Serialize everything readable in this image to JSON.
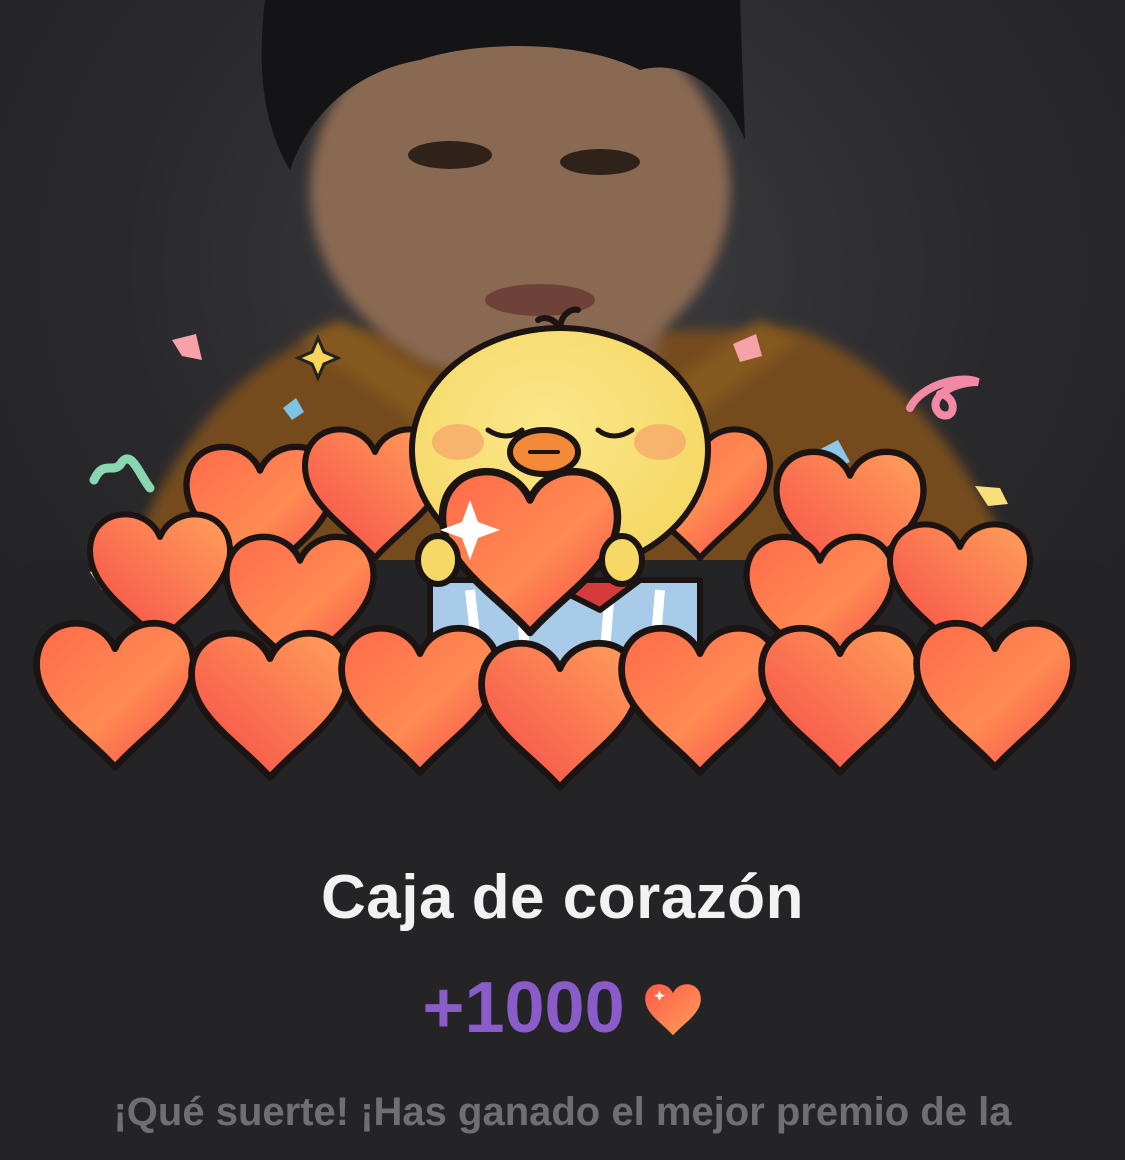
{
  "background": {
    "image": "blurred-portrait-photo",
    "colors": {
      "shirt": "#b87a2c",
      "skin": "#c99a79",
      "hair": "#1c1b1e"
    }
  },
  "reward_card": {
    "illustration": "chick-holding-heart-in-box-with-hearts-icon",
    "title": "Caja de corazón",
    "amount": "+1000",
    "currency_icon": "heart-icon",
    "description": "¡Qué suerte! ¡Has ganado el mejor premio de la"
  },
  "colors": {
    "title_text": "#f2f2f2",
    "amount_text": "#8a5cc9",
    "heart_light": "#ffa05a",
    "heart_dark": "#f4484a",
    "chick": "#f7df73",
    "sheet": "#242426"
  }
}
